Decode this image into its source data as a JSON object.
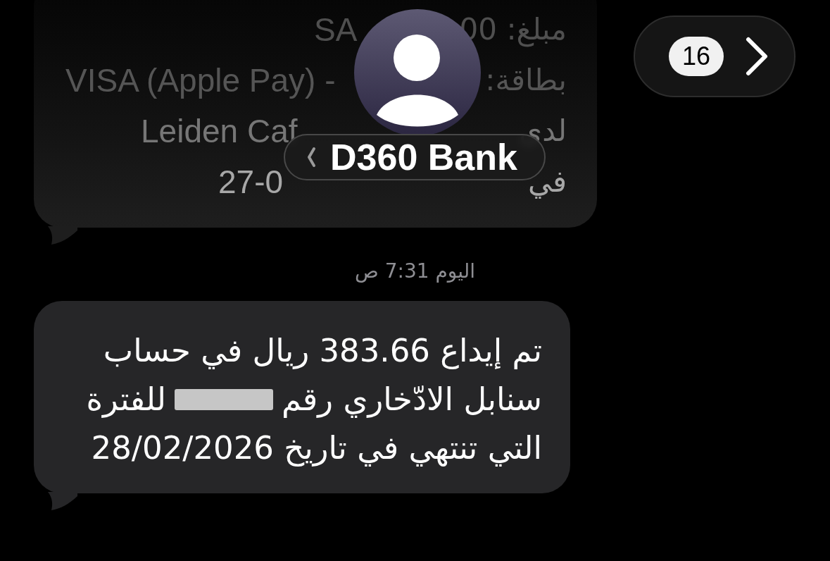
{
  "previous_message": {
    "lines": [
      {
        "end": "SA",
        "start": "مبلغ: 00"
      },
      {
        "end": "VISA (Apple Pay) -",
        "start": "بطاقة:"
      },
      {
        "end": "Leiden Caf",
        "start": "لدى"
      },
      {
        "end": "27-0",
        "start": "في"
      }
    ]
  },
  "unread_button": {
    "count": "16"
  },
  "contact": {
    "name": "D360 Bank"
  },
  "timestamp": "اليوم 7:31 ص",
  "message": {
    "lines": [
      {
        "segments": [
          {
            "kind": "text",
            "text": "تم إيداع 383.66 ريال في حساب"
          }
        ]
      },
      {
        "segments": [
          {
            "kind": "text",
            "text": "سنابل الادّخاري رقم"
          },
          {
            "kind": "redacted"
          },
          {
            "kind": "text",
            "text": "للفترة"
          }
        ]
      },
      {
        "segments": [
          {
            "kind": "text",
            "text": "التي تنتهي في تاريخ 28/02/2026"
          }
        ]
      }
    ]
  }
}
